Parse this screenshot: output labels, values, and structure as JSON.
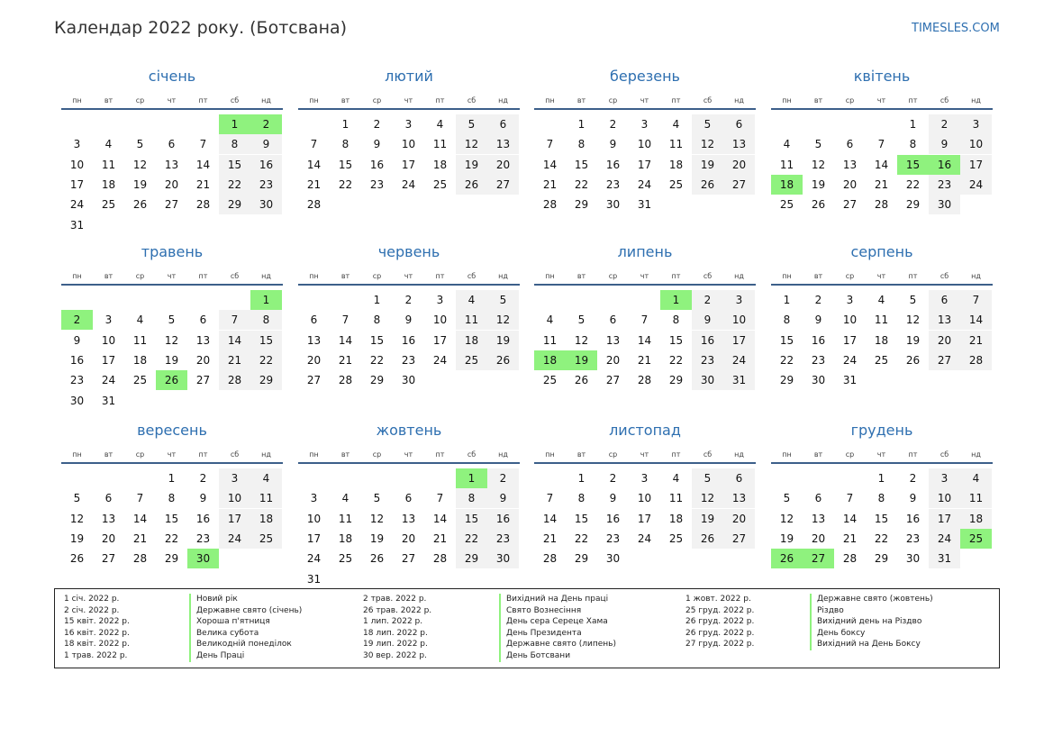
{
  "header": {
    "title": "Календар 2022 року. (Ботсвана)",
    "site": "TIMESLES.COM"
  },
  "colors": {
    "accent": "#2e6fb0",
    "holiday": "#8ff27e",
    "weekend": "#f2f2f2",
    "rule": "#3c5f8a"
  },
  "weekdays": [
    "пн",
    "вт",
    "ср",
    "чт",
    "пт",
    "сб",
    "нд"
  ],
  "months": [
    {
      "name": "січень",
      "first_weekday": 6,
      "days": 31,
      "holidays": [
        1,
        2
      ]
    },
    {
      "name": "лютий",
      "first_weekday": 2,
      "days": 28,
      "holidays": []
    },
    {
      "name": "березень",
      "first_weekday": 2,
      "days": 31,
      "holidays": []
    },
    {
      "name": "квітень",
      "first_weekday": 5,
      "days": 30,
      "holidays": [
        15,
        16,
        18
      ]
    },
    {
      "name": "травень",
      "first_weekday": 7,
      "days": 31,
      "holidays": [
        1,
        2,
        26
      ]
    },
    {
      "name": "червень",
      "first_weekday": 3,
      "days": 30,
      "holidays": []
    },
    {
      "name": "липень",
      "first_weekday": 5,
      "days": 31,
      "holidays": [
        1,
        18,
        19
      ]
    },
    {
      "name": "серпень",
      "first_weekday": 1,
      "days": 31,
      "holidays": []
    },
    {
      "name": "вересень",
      "first_weekday": 4,
      "days": 30,
      "holidays": [
        30
      ]
    },
    {
      "name": "жовтень",
      "first_weekday": 6,
      "days": 31,
      "holidays": [
        1
      ]
    },
    {
      "name": "листопад",
      "first_weekday": 2,
      "days": 30,
      "holidays": []
    },
    {
      "name": "грудень",
      "first_weekday": 4,
      "days": 31,
      "holidays": [
        25,
        26,
        27
      ]
    }
  ],
  "legend": {
    "dates": [
      [
        "1 січ. 2022 р.",
        "2 січ. 2022 р.",
        "15 квіт. 2022 р.",
        "16 квіт. 2022 р.",
        "18 квіт. 2022 р.",
        "1 трав. 2022 р."
      ],
      [
        "2 трав. 2022 р.",
        "26 трав. 2022 р.",
        "1 лип. 2022 р.",
        "18 лип. 2022 р.",
        "19 лип. 2022 р.",
        "30 вер. 2022 р."
      ],
      [
        "1 жовт. 2022 р.",
        "25 груд. 2022 р.",
        "26 груд. 2022 р.",
        "26 груд. 2022 р.",
        "27 груд. 2022 р."
      ]
    ],
    "names": [
      [
        "Новий рік",
        "Державне свято (січень)",
        "Хороша п'ятниця",
        "Велика субота",
        "Великодній понеділок",
        "День Праці"
      ],
      [
        "Вихідний на День праці",
        "Свято Вознесіння",
        "День сера Сереце Хама",
        "День Президента",
        "Державне свято (липень)",
        "День Ботсвани"
      ],
      [
        "Державне свято (жовтень)",
        "Різдво",
        "Вихідний день на Різдво",
        "День боксу",
        "Вихідний на День Боксу"
      ]
    ]
  }
}
